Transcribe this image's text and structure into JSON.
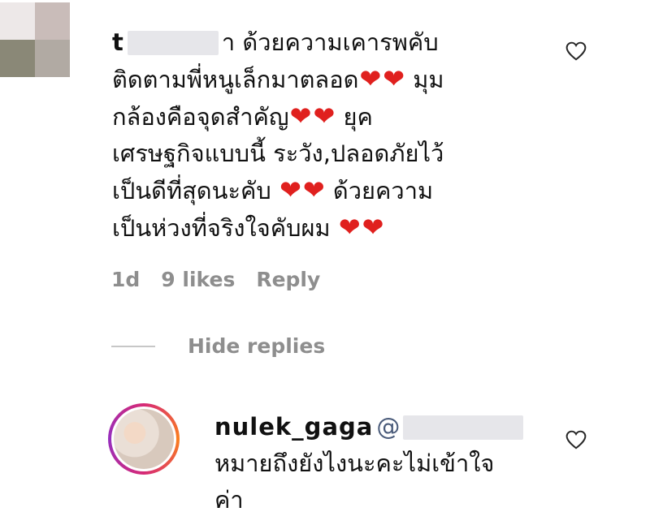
{
  "comment": {
    "username_visible": "t",
    "username_tail": "า",
    "lines": [
      "ด้วยความเคารพคับ",
      "ติดตามพี่หนูเล็กมาตลอด",
      "มุม",
      "กล้องคือจุดสำคัญ",
      "ยุค",
      "เศรษฐกิจแบบนี้ ระวัง,ปลอดภัยไว้",
      "เป็นดีที่สุดนะคับ",
      "ด้วยความ",
      "เป็นห่วงที่จริงใจคับผม"
    ],
    "heart_glyph": "❤",
    "time": "1d",
    "likes": "9 likes",
    "reply_label": "Reply"
  },
  "replies": {
    "toggle_label": "Hide replies"
  },
  "reply": {
    "username": "nulek_gaga",
    "mention_prefix": "@",
    "text_line1": "หมายถึงยังไงนะคะไม่เข้าใจ",
    "text_line2": "ค่า"
  },
  "colors": {
    "heart_emoji": "#e0201e",
    "muted_text": "#8e8e8e",
    "story_ring": "#d62976"
  },
  "icons": {
    "like": "heart-outline-icon"
  }
}
